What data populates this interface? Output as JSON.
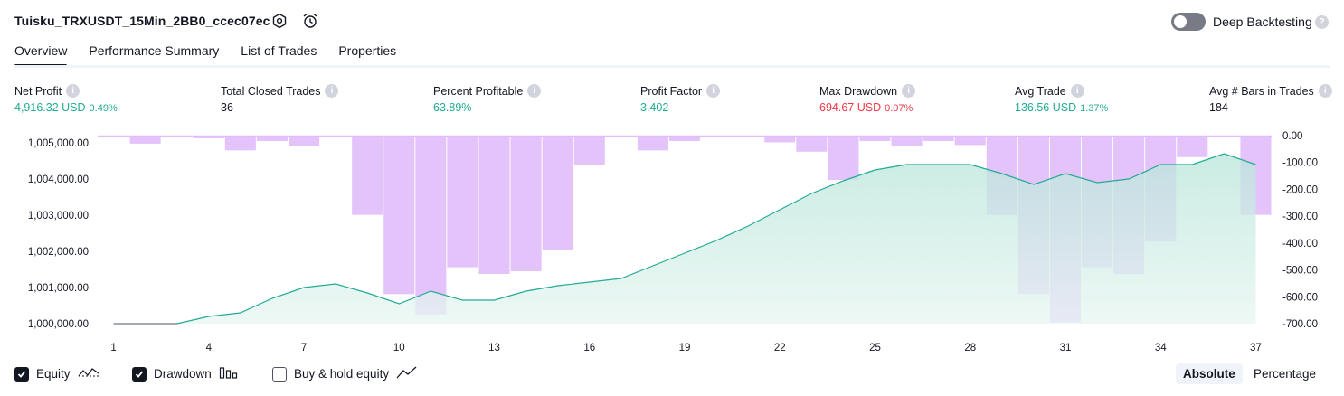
{
  "header": {
    "title": "Tuisku_TRXUSDT_15Min_2BB0_ccec07ec",
    "deep_backtesting_label": "Deep Backtesting",
    "deep_backtesting_enabled": false
  },
  "tabs": [
    {
      "label": "Overview",
      "active": true
    },
    {
      "label": "Performance Summary",
      "active": false
    },
    {
      "label": "List of Trades",
      "active": false
    },
    {
      "label": "Properties",
      "active": false
    }
  ],
  "metrics": [
    {
      "label": "Net Profit",
      "value": "4,916.32 USD",
      "pct": "0.49%",
      "color": "#22ab94"
    },
    {
      "label": "Total Closed Trades",
      "value": "36",
      "pct": "",
      "color": "#131722"
    },
    {
      "label": "Percent Profitable",
      "value": "63.89%",
      "pct": "",
      "color": "#22ab94"
    },
    {
      "label": "Profit Factor",
      "value": "3.402",
      "pct": "",
      "color": "#22ab94"
    },
    {
      "label": "Max Drawdown",
      "value": "694.67 USD",
      "pct": "0.07%",
      "color": "#f23645"
    },
    {
      "label": "Avg Trade",
      "value": "136.56 USD",
      "pct": "1.37%",
      "color": "#22ab94"
    },
    {
      "label": "Avg # Bars in Trades",
      "value": "184",
      "pct": "",
      "color": "#131722"
    }
  ],
  "legend": {
    "equity": {
      "label": "Equity",
      "checked": true
    },
    "drawdown": {
      "label": "Drawdown",
      "checked": true
    },
    "buy_hold": {
      "label": "Buy & hold equity",
      "checked": false
    }
  },
  "view_mode": {
    "absolute": "Absolute",
    "percentage": "Percentage",
    "selected": "Absolute"
  },
  "colors": {
    "equity_line": "#22ab94",
    "equity_fill": "#cdeee6",
    "drawdown": "#e1bcfb",
    "accent": "#131722"
  },
  "chart_data": {
    "type": "area",
    "x": [
      1,
      2,
      3,
      4,
      5,
      6,
      7,
      8,
      9,
      10,
      11,
      12,
      13,
      14,
      15,
      16,
      17,
      18,
      19,
      20,
      21,
      22,
      23,
      24,
      25,
      26,
      27,
      28,
      29,
      30,
      31,
      32,
      33,
      34,
      35,
      36,
      37
    ],
    "x_ticks": [
      1,
      4,
      7,
      10,
      13,
      16,
      19,
      22,
      25,
      28,
      31,
      34,
      37
    ],
    "y_left_ticks": [
      "1,000,000.00",
      "1,001,000.00",
      "1,002,000.00",
      "1,003,000.00",
      "1,004,000.00",
      "1,005,000.00"
    ],
    "y_right_ticks": [
      "0.00",
      "-100.00",
      "-200.00",
      "-300.00",
      "-400.00",
      "-500.00",
      "-600.00",
      "-700.00"
    ],
    "ylim_left": [
      1000000,
      1005200
    ],
    "ylim_right": [
      -700,
      0
    ],
    "series": [
      {
        "name": "Equity",
        "type": "line",
        "values": [
          1000000,
          1000000,
          1000000,
          1000200,
          1000300,
          1000700,
          1001000,
          1001100,
          1000850,
          1000550,
          1000900,
          1000650,
          1000650,
          1000900,
          1001050,
          1001150,
          1001250,
          1001600,
          1001950,
          1002300,
          1002700,
          1003150,
          1003600,
          1003950,
          1004250,
          1004400,
          1004400,
          1004400,
          1004150,
          1003850,
          1004150,
          1003900,
          1004000,
          1004400,
          1004400,
          1004700,
          1004400
        ]
      },
      {
        "name": "Drawdown",
        "type": "bar",
        "values": [
          -5,
          -30,
          -5,
          -10,
          -55,
          -20,
          -40,
          -5,
          -295,
          -590,
          -665,
          -490,
          -515,
          -505,
          -425,
          -110,
          0,
          -55,
          -20,
          -5,
          -5,
          -25,
          -60,
          -165,
          -20,
          -40,
          -20,
          -35,
          -295,
          -590,
          -695,
          -490,
          -515,
          -395,
          -80,
          0,
          -295
        ]
      }
    ]
  }
}
